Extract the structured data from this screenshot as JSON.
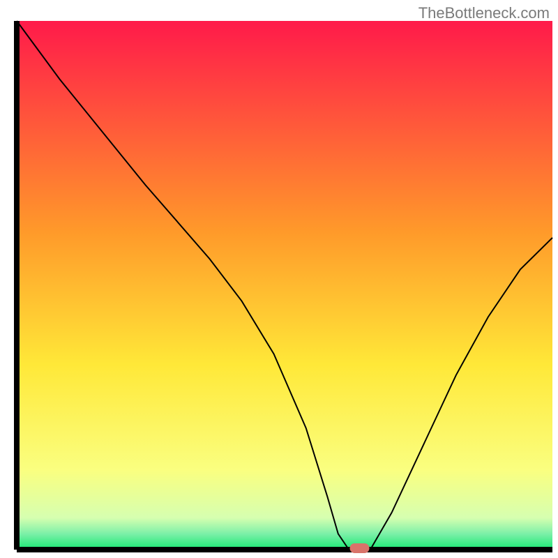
{
  "watermark": "TheBottleneck.com",
  "chart_data": {
    "type": "line",
    "title": "",
    "xlabel": "",
    "ylabel": "",
    "xlim": [
      0,
      100
    ],
    "ylim": [
      0,
      100
    ],
    "x": [
      0,
      8,
      16,
      24,
      30,
      36,
      42,
      48,
      54,
      58,
      60,
      62,
      64,
      66,
      70,
      76,
      82,
      88,
      94,
      100
    ],
    "y": [
      100,
      89,
      79,
      69,
      62,
      55,
      47,
      37,
      23,
      10,
      3,
      0,
      0,
      0,
      7,
      20,
      33,
      44,
      53,
      59
    ],
    "series_name": "bottleneck-curve",
    "marker": {
      "x": 64,
      "y": 0,
      "color": "#d9736a"
    },
    "background": {
      "type": "vertical-gradient",
      "stops": [
        {
          "offset": 0.0,
          "color": "#ff1a4a"
        },
        {
          "offset": 0.4,
          "color": "#ff9a2a"
        },
        {
          "offset": 0.65,
          "color": "#ffe838"
        },
        {
          "offset": 0.85,
          "color": "#faff80"
        },
        {
          "offset": 0.94,
          "color": "#d6ffb0"
        },
        {
          "offset": 0.97,
          "color": "#7cf0a8"
        },
        {
          "offset": 1.0,
          "color": "#17e872"
        }
      ]
    },
    "axes_color": "#000000",
    "line_color": "#000000",
    "line_width": 2
  }
}
